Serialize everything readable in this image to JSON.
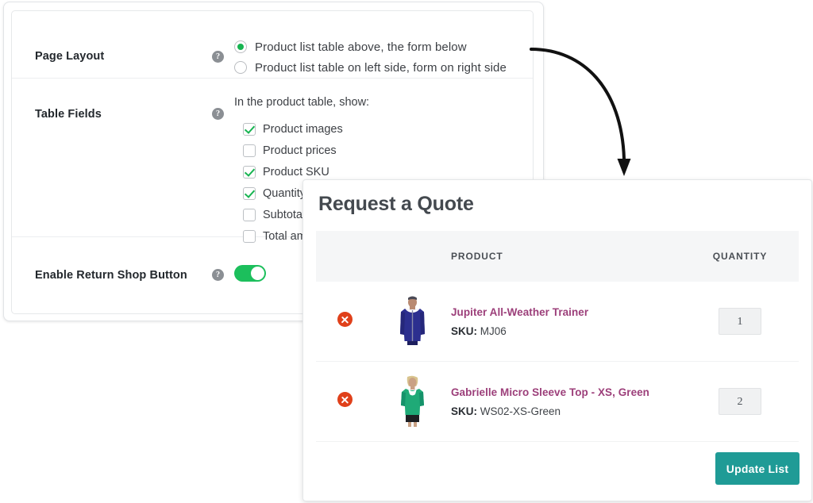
{
  "settings": {
    "rows": [
      {
        "label": "Page Layout",
        "help_icon": "question-mark-icon",
        "options": [
          {
            "label": "Product list table above, the form below",
            "checked": true
          },
          {
            "label": "Product list table on left side, form on right side",
            "checked": false
          }
        ]
      },
      {
        "label": "Table Fields",
        "help_icon": "question-mark-icon",
        "intro": "In the product table, show:",
        "checkboxes": [
          {
            "label": "Product images",
            "checked": true
          },
          {
            "label": "Product prices",
            "checked": false
          },
          {
            "label": "Product SKU",
            "checked": true
          },
          {
            "label": "Quantity",
            "checked": true
          },
          {
            "label": "Subtotal ",
            "checked": false
          },
          {
            "label": "Total amo",
            "checked": false
          }
        ]
      },
      {
        "label": "Enable Return Shop Button",
        "help_icon": "question-mark-icon",
        "toggle_on": true
      }
    ]
  },
  "quote": {
    "title": "Request a Quote",
    "table": {
      "headers": [
        "",
        "",
        "PRODUCT",
        "QUANTITY"
      ],
      "rows": [
        {
          "remove_icon": "remove-circle-icon",
          "image": "product-thumbnail-jacket",
          "name": "Jupiter All-Weather Trainer",
          "sku_label": "SKU:",
          "sku_value": "MJ06",
          "quantity": "1"
        },
        {
          "remove_icon": "remove-circle-icon",
          "image": "product-thumbnail-top",
          "name": "Gabrielle Micro Sleeve Top - XS, Green",
          "sku_label": "SKU:",
          "sku_value": "WS02-XS-Green",
          "quantity": "2"
        }
      ]
    },
    "update_button": "Update List"
  },
  "colors": {
    "green_accent": "#17b451",
    "toggle_on": "#1cbf5c",
    "product_link": "#9c3f7a",
    "remove_red": "#e0401a",
    "button_teal": "#1f9b96",
    "header_bg": "#f5f6f7"
  }
}
